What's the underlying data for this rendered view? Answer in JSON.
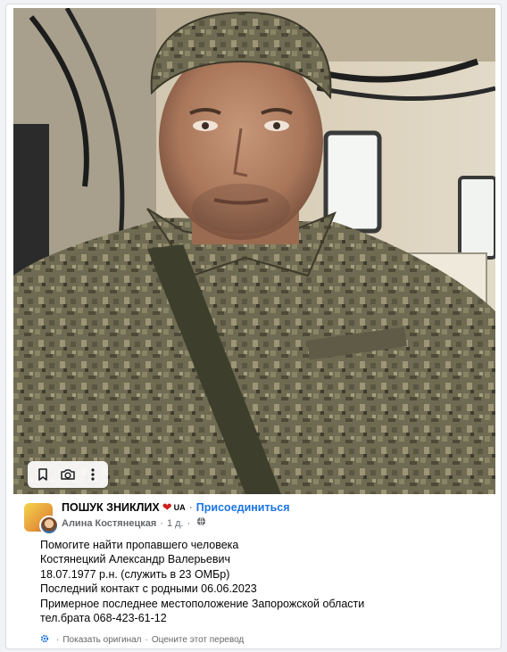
{
  "post": {
    "group_name": "ПОШУК ЗНИКЛИХ",
    "group_tag": "UA",
    "separator": "·",
    "join_label": "Присоединиться",
    "author": "Алина Костянецкая",
    "time": "1 д.",
    "lines": [
      "Помогите найти пропавшего человека",
      "Костянецкий Александр Валерьевич",
      "18.07.1977 р.н. (служить в 23 ОМБр)",
      "Последний контакт с родными 06.06.2023",
      "Примерное последнее местоположение Запорожской области",
      "тел.брата 068-423-61-12"
    ]
  },
  "photo_actions": {
    "save_icon": "bookmark-icon",
    "camera_icon": "camera-icon",
    "more_icon": "more-vertical-icon"
  },
  "translation": {
    "show_original": "Показать оригинал",
    "separator": "·",
    "rate": "Оцените этот перевод"
  },
  "colors": {
    "link": "#1b74e4",
    "secondary_text": "#65676b",
    "heart": "#d0201c"
  }
}
